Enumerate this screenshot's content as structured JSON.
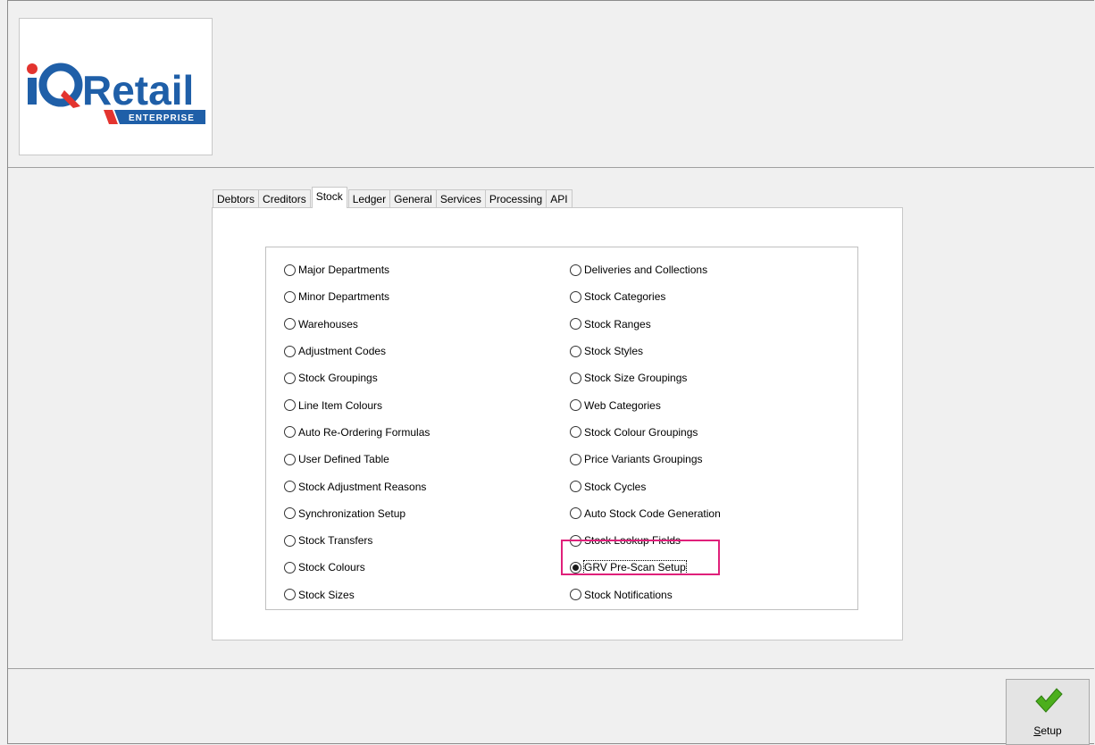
{
  "logo": {
    "brand_i": "i",
    "brand_q": "Q",
    "brand_name": "Retail",
    "tagline": "ENTERPRISE"
  },
  "tabs": [
    {
      "label": "Debtors",
      "active": false
    },
    {
      "label": "Creditors",
      "active": false
    },
    {
      "label": "Stock",
      "active": true
    },
    {
      "label": "Ledger",
      "active": false
    },
    {
      "label": "General",
      "active": false
    },
    {
      "label": "Services",
      "active": false
    },
    {
      "label": "Processing",
      "active": false
    },
    {
      "label": "API",
      "active": false
    }
  ],
  "options": {
    "left": [
      "Major Departments",
      "Minor Departments",
      "Warehouses",
      "Adjustment Codes",
      "Stock Groupings",
      "Line Item Colours",
      "Auto Re-Ordering Formulas",
      "User Defined Table",
      "Stock Adjustment Reasons",
      "Synchronization Setup",
      "Stock Transfers",
      "Stock Colours",
      "Stock Sizes"
    ],
    "right": [
      "Deliveries and Collections",
      "Stock Categories",
      "Stock Ranges",
      "Stock Styles",
      "Stock Size Groupings",
      "Web Categories",
      "Stock Colour Groupings",
      "Price Variants Groupings",
      "Stock Cycles",
      "Auto Stock Code Generation",
      "Stock Lookup Fields",
      "GRV Pre-Scan Setup",
      "Stock Notifications"
    ],
    "selected": "GRV Pre-Scan Setup"
  },
  "footer": {
    "setup_label": "Setup"
  },
  "colors": {
    "brand_blue": "#1f5fa8",
    "brand_red": "#e3342f",
    "highlight": "#e0207a",
    "check_green": "#4caf1c"
  },
  "icons": {
    "setup": "checkmark-icon"
  }
}
